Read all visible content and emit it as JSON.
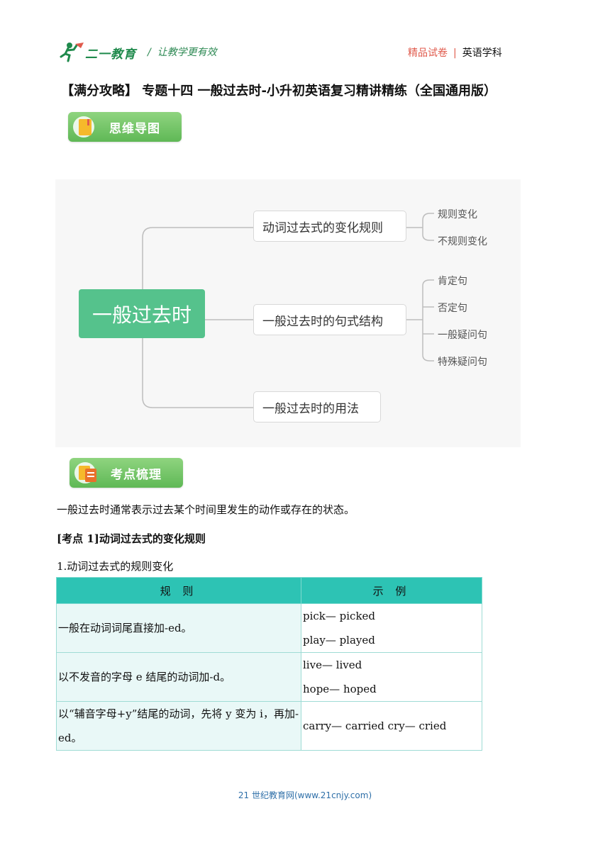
{
  "header": {
    "logo_text": "二一教育",
    "slogan": "让教学更有效",
    "tag_left": "精品试卷",
    "separator": "|",
    "tag_right": "英语学科"
  },
  "title": "【满分攻略】 专题十四  一般过去时-小升初英语复习精讲精练（全国通用版）",
  "badges": {
    "mindmap": "思维导图",
    "points": "考点梳理"
  },
  "mindmap": {
    "root": "一般过去时",
    "branches": [
      {
        "label": "动词过去式的变化规则",
        "leaves": [
          "规则变化",
          "不规则变化"
        ]
      },
      {
        "label": "一般过去时的句式结构",
        "leaves": [
          "肯定句",
          "否定句",
          "一般疑问句",
          "特殊疑问句"
        ]
      },
      {
        "label": "一般过去时的用法",
        "leaves": []
      }
    ]
  },
  "intro": "一般过去时通常表示过去某个时间里发生的动作或存在的状态。",
  "kaodian1": "[考点 1]动词过去式的变化规则",
  "subheading": "1.动词过去式的规则变化",
  "table": {
    "headers": [
      "规 则",
      "示 例"
    ],
    "rows": [
      {
        "rule": "一般在动词词尾直接加-ed。",
        "examples": [
          "pick— picked",
          "play— played"
        ]
      },
      {
        "rule": "以不发音的字母 e 结尾的动词加-d。",
        "examples": [
          "live— lived",
          "hope— hoped"
        ]
      },
      {
        "rule": "以“辅音字母+y”结尾的动词，先将 y 变为 i，再加-ed。",
        "examples": [
          "carry— carried cry— cried"
        ]
      }
    ]
  },
  "footer": "21 世纪教育网(www.21cnjy.com)",
  "colors": {
    "accent_green": "#55c28c",
    "badge_green": "#6cc35f",
    "table_header": "#2dc3b4",
    "table_cell": "#e9f8f7",
    "red": "#e05a4c"
  }
}
